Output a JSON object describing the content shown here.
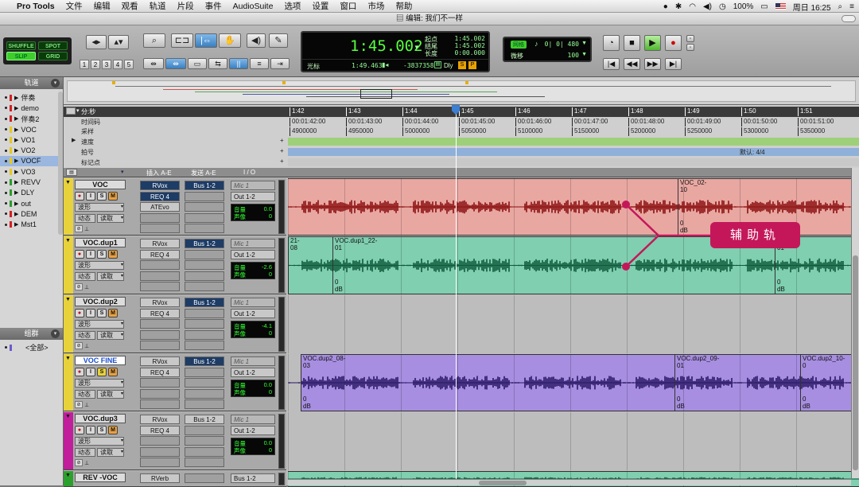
{
  "menubar": {
    "app": "Pro Tools",
    "items": [
      "文件",
      "编辑",
      "观看",
      "轨道",
      "片段",
      "事件",
      "AudioSuite",
      "选项",
      "设置",
      "窗口",
      "市场",
      "帮助"
    ],
    "battery": "100%",
    "clock": "周日 16:25"
  },
  "window": {
    "title": "编辑: 我们不一样"
  },
  "edit_modes": {
    "shuffle": "SHUFFLE",
    "spot": "SPOT",
    "slip": "SLIP",
    "grid": "GRID"
  },
  "zoom_presets": [
    "1",
    "2",
    "3",
    "4",
    "5"
  ],
  "counter": {
    "main": "1:45.002",
    "start_label": "起点",
    "end_label": "结尾",
    "length_label": "长度",
    "start": "1:45.002",
    "end": "1:45.002",
    "length": "0:00.000",
    "cursor_label": "光标",
    "cursor": "1:49.463",
    "sample_offset": "-3837358",
    "dly": "Dly"
  },
  "grid_panel": {
    "grid_label": "网格",
    "grid_value": "0| 0| 480",
    "nudge_label": "微移",
    "nudge_value": "100"
  },
  "left_panel": {
    "tracks_title": "轨道",
    "tracks": [
      {
        "name": "伴奏",
        "color": "#d42020"
      },
      {
        "name": "demo",
        "color": "#d42020"
      },
      {
        "name": "伴奏2",
        "color": "#d42020"
      },
      {
        "name": "VOC",
        "color": "#e6c81c"
      },
      {
        "name": "VO1",
        "color": "#e6c81c"
      },
      {
        "name": "VO2",
        "color": "#e6c81c"
      },
      {
        "name": "VOCF",
        "color": "#e6c81c",
        "selected": true
      },
      {
        "name": "VO3",
        "color": "#e6c81c"
      },
      {
        "name": "REVV",
        "color": "#2c9c2c"
      },
      {
        "name": "DLY",
        "color": "#2c9c2c"
      },
      {
        "name": "out",
        "color": "#2c9c2c"
      },
      {
        "name": "DEM",
        "color": "#d42020"
      },
      {
        "name": "Mst1",
        "color": "#d42020"
      }
    ],
    "groups_title": "组群",
    "groups": [
      {
        "name": "<全部>"
      }
    ]
  },
  "rulers": {
    "minsec": "分:秒",
    "timecode": "时间码",
    "samples": "采样",
    "tempo": "速度",
    "meter": "拍号",
    "markers": "标记点",
    "meter_default": "默认: 4/4",
    "minsec_ticks": [
      "1:42",
      "1:43",
      "1:44",
      "1:45",
      "1:46",
      "1:47",
      "1:48",
      "1:49",
      "1:50",
      "1:51"
    ],
    "tc_ticks": [
      "00:01:42:00",
      "00:01:43:00",
      "00:01:44:00",
      "00:01:45:00",
      "00:01:46:00",
      "00:01:47:00",
      "00:01:48:00",
      "00:01:49:00",
      "00:01:50:00",
      "00:01:51:00"
    ],
    "sample_ticks": [
      "4900000",
      "4950000",
      "5000000",
      "5050000",
      "5100000",
      "5150000",
      "5200000",
      "5250000",
      "5300000",
      "5350000"
    ]
  },
  "columns": {
    "inserts": "插入 A-E",
    "sends": "发送 A-E",
    "io": "I / O"
  },
  "track_labels": {
    "waveform": "波形",
    "auto": "动态",
    "read": "读取",
    "vol": "音量",
    "pan": "声像"
  },
  "tracks": [
    {
      "name": "VOC",
      "inserts": [
        "RVox",
        "REQ 4",
        "ATEvo"
      ],
      "send": "Bus 1-2",
      "input": "Mic 1",
      "output": "Out 1-2",
      "volume": "0.0",
      "pan": "0",
      "lane": "VOC_02-10",
      "gain": "0 dB"
    },
    {
      "name": "VOC.dup1",
      "inserts": [
        "RVox",
        "REQ 4"
      ],
      "send": "Bus 1-2",
      "input": "Mic 1",
      "output": "Out 1-2",
      "volume": "-2.6",
      "pan": "0",
      "clips": [
        "21-08",
        "VOC.dup1_22-01",
        "1_23-01"
      ],
      "gain": "0 dB"
    },
    {
      "name": "VOC.dup2",
      "inserts": [
        "RVox",
        "REQ 4"
      ],
      "send": "Bus 1-2",
      "input": "Mic 1",
      "output": "Out 1-2",
      "volume": "-4.1",
      "pan": "0"
    },
    {
      "name": "VOC FINE",
      "inserts": [
        "RVox",
        "REQ 4"
      ],
      "send": "Bus 1-2",
      "input": "Mic 1",
      "output": "Out 1-2",
      "volume": "0.0",
      "pan": "0",
      "clips": [
        "VOC.dup2_08-03",
        "VOC.dup2_09-01",
        "VOC.dup2_10-0"
      ],
      "gain": "0 dB"
    },
    {
      "name": "VOC.dup3",
      "inserts": [
        "RVox",
        "REQ 4"
      ],
      "send": "Bus 1-2",
      "input": "Mic 1",
      "output": "Out 1-2",
      "volume": "0.0",
      "pan": "0"
    },
    {
      "name": "REV -VOC",
      "inserts": [
        "RVerb"
      ],
      "send": "",
      "input": "",
      "output": "Bus 1-2"
    }
  ],
  "callout": {
    "text": "辅助轨"
  }
}
